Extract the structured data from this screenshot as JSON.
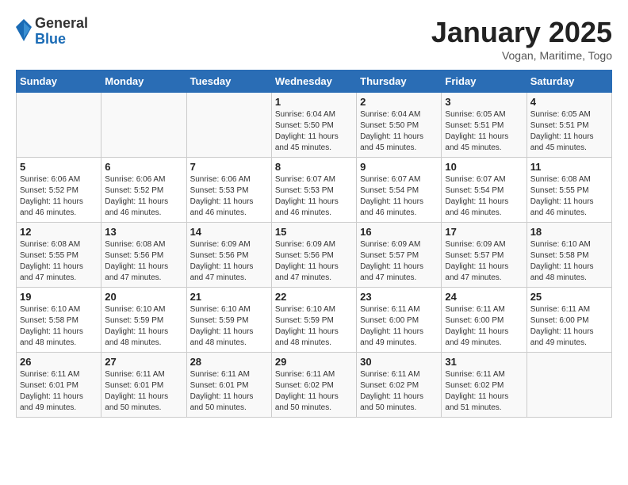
{
  "header": {
    "logo_general": "General",
    "logo_blue": "Blue",
    "month": "January 2025",
    "location": "Vogan, Maritime, Togo"
  },
  "days_of_week": [
    "Sunday",
    "Monday",
    "Tuesday",
    "Wednesday",
    "Thursday",
    "Friday",
    "Saturday"
  ],
  "weeks": [
    [
      {
        "day": "",
        "info": ""
      },
      {
        "day": "",
        "info": ""
      },
      {
        "day": "",
        "info": ""
      },
      {
        "day": "1",
        "info": "Sunrise: 6:04 AM\nSunset: 5:50 PM\nDaylight: 11 hours\nand 45 minutes."
      },
      {
        "day": "2",
        "info": "Sunrise: 6:04 AM\nSunset: 5:50 PM\nDaylight: 11 hours\nand 45 minutes."
      },
      {
        "day": "3",
        "info": "Sunrise: 6:05 AM\nSunset: 5:51 PM\nDaylight: 11 hours\nand 45 minutes."
      },
      {
        "day": "4",
        "info": "Sunrise: 6:05 AM\nSunset: 5:51 PM\nDaylight: 11 hours\nand 45 minutes."
      }
    ],
    [
      {
        "day": "5",
        "info": "Sunrise: 6:06 AM\nSunset: 5:52 PM\nDaylight: 11 hours\nand 46 minutes."
      },
      {
        "day": "6",
        "info": "Sunrise: 6:06 AM\nSunset: 5:52 PM\nDaylight: 11 hours\nand 46 minutes."
      },
      {
        "day": "7",
        "info": "Sunrise: 6:06 AM\nSunset: 5:53 PM\nDaylight: 11 hours\nand 46 minutes."
      },
      {
        "day": "8",
        "info": "Sunrise: 6:07 AM\nSunset: 5:53 PM\nDaylight: 11 hours\nand 46 minutes."
      },
      {
        "day": "9",
        "info": "Sunrise: 6:07 AM\nSunset: 5:54 PM\nDaylight: 11 hours\nand 46 minutes."
      },
      {
        "day": "10",
        "info": "Sunrise: 6:07 AM\nSunset: 5:54 PM\nDaylight: 11 hours\nand 46 minutes."
      },
      {
        "day": "11",
        "info": "Sunrise: 6:08 AM\nSunset: 5:55 PM\nDaylight: 11 hours\nand 46 minutes."
      }
    ],
    [
      {
        "day": "12",
        "info": "Sunrise: 6:08 AM\nSunset: 5:55 PM\nDaylight: 11 hours\nand 47 minutes."
      },
      {
        "day": "13",
        "info": "Sunrise: 6:08 AM\nSunset: 5:56 PM\nDaylight: 11 hours\nand 47 minutes."
      },
      {
        "day": "14",
        "info": "Sunrise: 6:09 AM\nSunset: 5:56 PM\nDaylight: 11 hours\nand 47 minutes."
      },
      {
        "day": "15",
        "info": "Sunrise: 6:09 AM\nSunset: 5:56 PM\nDaylight: 11 hours\nand 47 minutes."
      },
      {
        "day": "16",
        "info": "Sunrise: 6:09 AM\nSunset: 5:57 PM\nDaylight: 11 hours\nand 47 minutes."
      },
      {
        "day": "17",
        "info": "Sunrise: 6:09 AM\nSunset: 5:57 PM\nDaylight: 11 hours\nand 47 minutes."
      },
      {
        "day": "18",
        "info": "Sunrise: 6:10 AM\nSunset: 5:58 PM\nDaylight: 11 hours\nand 48 minutes."
      }
    ],
    [
      {
        "day": "19",
        "info": "Sunrise: 6:10 AM\nSunset: 5:58 PM\nDaylight: 11 hours\nand 48 minutes."
      },
      {
        "day": "20",
        "info": "Sunrise: 6:10 AM\nSunset: 5:59 PM\nDaylight: 11 hours\nand 48 minutes."
      },
      {
        "day": "21",
        "info": "Sunrise: 6:10 AM\nSunset: 5:59 PM\nDaylight: 11 hours\nand 48 minutes."
      },
      {
        "day": "22",
        "info": "Sunrise: 6:10 AM\nSunset: 5:59 PM\nDaylight: 11 hours\nand 48 minutes."
      },
      {
        "day": "23",
        "info": "Sunrise: 6:11 AM\nSunset: 6:00 PM\nDaylight: 11 hours\nand 49 minutes."
      },
      {
        "day": "24",
        "info": "Sunrise: 6:11 AM\nSunset: 6:00 PM\nDaylight: 11 hours\nand 49 minutes."
      },
      {
        "day": "25",
        "info": "Sunrise: 6:11 AM\nSunset: 6:00 PM\nDaylight: 11 hours\nand 49 minutes."
      }
    ],
    [
      {
        "day": "26",
        "info": "Sunrise: 6:11 AM\nSunset: 6:01 PM\nDaylight: 11 hours\nand 49 minutes."
      },
      {
        "day": "27",
        "info": "Sunrise: 6:11 AM\nSunset: 6:01 PM\nDaylight: 11 hours\nand 50 minutes."
      },
      {
        "day": "28",
        "info": "Sunrise: 6:11 AM\nSunset: 6:01 PM\nDaylight: 11 hours\nand 50 minutes."
      },
      {
        "day": "29",
        "info": "Sunrise: 6:11 AM\nSunset: 6:02 PM\nDaylight: 11 hours\nand 50 minutes."
      },
      {
        "day": "30",
        "info": "Sunrise: 6:11 AM\nSunset: 6:02 PM\nDaylight: 11 hours\nand 50 minutes."
      },
      {
        "day": "31",
        "info": "Sunrise: 6:11 AM\nSunset: 6:02 PM\nDaylight: 11 hours\nand 51 minutes."
      },
      {
        "day": "",
        "info": ""
      }
    ]
  ]
}
